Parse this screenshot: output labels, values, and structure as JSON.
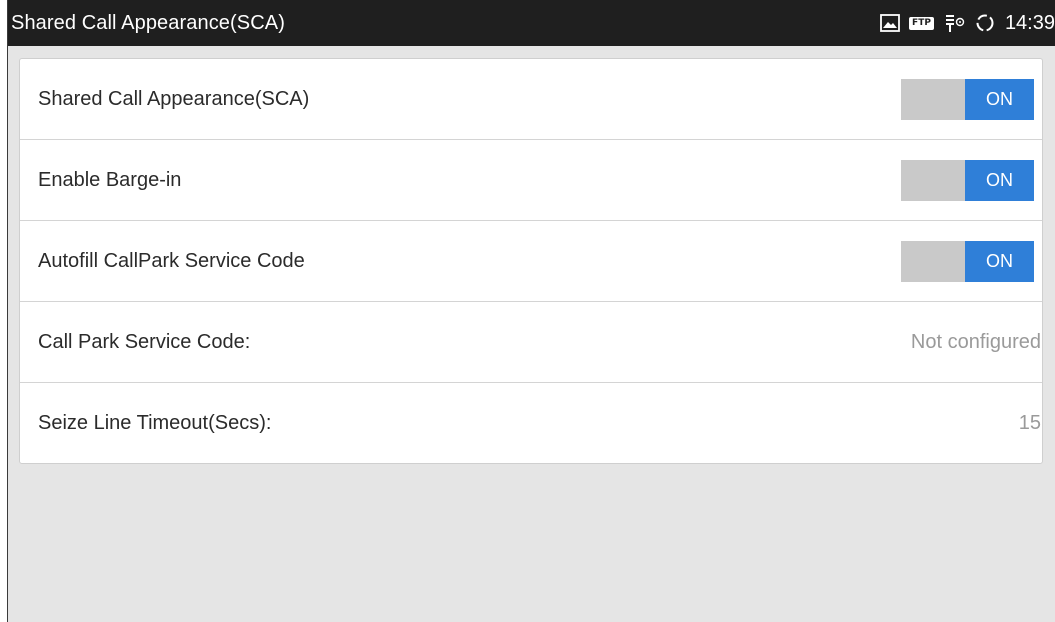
{
  "statusbar": {
    "title": "Shared Call Appearance(SCA)",
    "icons": [
      "image-icon",
      "ftp-icon",
      "usb-debug-icon",
      "sync-icon"
    ],
    "ftp_label": "FTP",
    "time": "14:39"
  },
  "settings": [
    {
      "label": "Shared Call Appearance(SCA)",
      "type": "toggle",
      "state": "ON"
    },
    {
      "label": "Enable Barge-in",
      "type": "toggle",
      "state": "ON"
    },
    {
      "label": "Autofill CallPark Service Code",
      "type": "toggle",
      "state": "ON"
    },
    {
      "label": "Call Park Service Code:",
      "type": "value",
      "value": "Not configured"
    },
    {
      "label": "Seize Line Timeout(Secs):",
      "type": "value",
      "value": "15"
    }
  ],
  "colors": {
    "accent": "#2f7fd8",
    "toggle_off": "#c9c9c9",
    "statusbar_bg": "#1f1f1f",
    "page_bg": "#e5e5e5"
  }
}
